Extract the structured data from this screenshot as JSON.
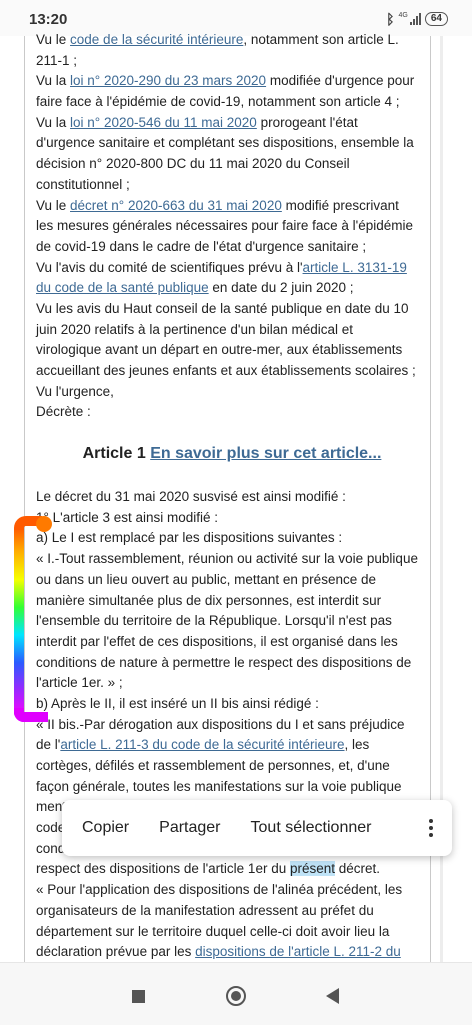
{
  "status_bar": {
    "time": "13:20",
    "network_label": "4G",
    "battery": "64"
  },
  "lines_top": [
    [
      {
        "t": "Vu le "
      },
      {
        "t": "code de la sécurité intérieure",
        "link": true
      },
      {
        "t": ", notamment son article L."
      }
    ],
    [
      {
        "t": "211-1 ;"
      }
    ],
    [
      {
        "t": "Vu la "
      },
      {
        "t": "loi n° 2020-290 du 23 mars 2020",
        "link": true
      },
      {
        "t": " modifiée d'urgence pour"
      }
    ],
    [
      {
        "t": "faire face à l'épidémie de covid-19, notamment son article 4 ;"
      }
    ],
    [
      {
        "t": "Vu la "
      },
      {
        "t": "loi n° 2020-546 du 11 mai 2020",
        "link": true
      },
      {
        "t": " prorogeant l'état"
      }
    ],
    [
      {
        "t": "d'urgence sanitaire et complétant ses dispositions, ensemble la"
      }
    ],
    [
      {
        "t": "décision n° 2020-800 DC du 11 mai 2020 du Conseil"
      }
    ],
    [
      {
        "t": "constitutionnel ;"
      }
    ],
    [
      {
        "t": "Vu le "
      },
      {
        "t": "décret n° 2020-663 du 31 mai 2020",
        "link": true
      },
      {
        "t": " modifié prescrivant"
      }
    ],
    [
      {
        "t": "les mesures générales nécessaires pour faire face à l'épidémie"
      }
    ],
    [
      {
        "t": "de covid-19 dans le cadre de l'état d'urgence sanitaire ;"
      }
    ],
    [
      {
        "t": "Vu l'avis du comité de scientifiques prévu à l'"
      },
      {
        "t": "article L. 3131-19",
        "link": true
      }
    ],
    [
      {
        "t": "du code de la santé publique",
        "link": true
      },
      {
        "t": " en date du 2 juin 2020 ;"
      }
    ],
    [
      {
        "t": "Vu les avis du Haut conseil de la santé publique en date du 10"
      }
    ],
    [
      {
        "t": "juin 2020 relatifs à la pertinence d'un bilan médical et"
      }
    ],
    [
      {
        "t": "virologique avant un départ en outre-mer, aux établissements"
      }
    ],
    [
      {
        "t": "accueillant des jeunes enfants et aux établissements scolaires ;"
      }
    ],
    [
      {
        "t": "Vu l'urgence,"
      }
    ],
    [
      {
        "t": "Décrète :"
      }
    ]
  ],
  "article_heading": {
    "title": "Article 1",
    "link": "En savoir plus sur cet article..."
  },
  "lines_bottom": [
    [
      {
        "t": "Le décret du 31 mai 2020 susvisé est ainsi modifié :"
      }
    ],
    [
      {
        "t": "1° L'article 3 est ainsi modifié :"
      }
    ],
    [
      {
        "t": "a) Le I est remplacé par les dispositions suivantes :"
      }
    ],
    [
      {
        "t": "« I.-Tout rassemblement, réunion ou activité sur la voie publique"
      }
    ],
    [
      {
        "t": "ou dans un lieu ouvert au public, mettant en présence de"
      }
    ],
    [
      {
        "t": "manière simultanée plus de dix personnes, est interdit sur"
      }
    ],
    [
      {
        "t": "l'ensemble du territoire de la République. Lorsqu'il n'est pas"
      }
    ],
    [
      {
        "t": "interdit par l'effet de ces dispositions, il est organisé dans les"
      }
    ],
    [
      {
        "t": "conditions de nature à permettre le respect des dispositions de"
      }
    ],
    [
      {
        "t": "l'article 1er. » ;"
      }
    ],
    [
      {
        "t": "b) Après le II, il est inséré un II bis ainsi rédigé :"
      }
    ],
    [
      {
        "t": "« II bis.-Par dérogation aux dispositions du I et sans préjudice"
      }
    ],
    [
      {
        "t": "de l'"
      },
      {
        "t": "article L. 211-3 du code de la sécurité intérieure",
        "link": true
      },
      {
        "t": ", les"
      }
    ],
    [
      {
        "t": "cortèges, défilés et rassemblement de personnes, et, d'une"
      }
    ],
    [
      {
        "t": "façon générale, toutes les manifestations sur la voie publique"
      }
    ],
    [
      {
        "t": "mentionnées au premier alinéa de l'article L. 211-1 du même"
      }
    ],
    [
      {
        "t": "code sont autorisés par le préfet de département si les"
      }
    ],
    [
      {
        "t": "conditions de leur organisation sont propres à garantir le"
      }
    ],
    [
      {
        "t": "respect des dispositions de l'article 1er du "
      },
      {
        "t": "présent",
        "hl": true
      },
      {
        "t": " décret."
      }
    ],
    [
      {
        "t": "« Pour l'application des dispositions de l'alinéa précédent, les"
      }
    ],
    [
      {
        "t": "organisateurs de la manifestation adressent au préfet du"
      }
    ],
    [
      {
        "t": "département sur le territoire duquel celle-ci doit avoir lieu la"
      }
    ],
    [
      {
        "t": "déclaration prévue par les "
      },
      {
        "t": "dispositions de l'article L. 211-2 du",
        "link": true
      }
    ]
  ],
  "context_menu": {
    "copy": "Copier",
    "share": "Partager",
    "select_all": "Tout sélectionner"
  }
}
